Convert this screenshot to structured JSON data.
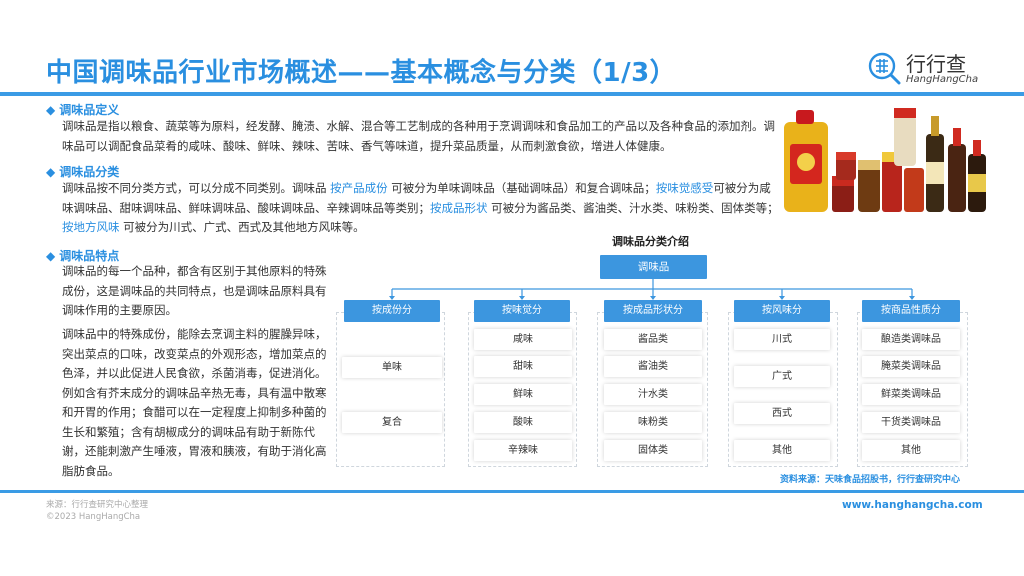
{
  "header": {
    "title": "中国调味品行业市场概述——基本概念与分类（1/3）",
    "logo_cn": "行行查",
    "logo_en": "HangHangCha"
  },
  "sections": {
    "definition": {
      "heading": "调味品定义",
      "text": "调味品是指以粮食、蔬菜等为原料，经发酵、腌渍、水解、混合等工艺制成的各种用于烹调调味和食品加工的产品以及各种食品的添加剂。调味品可以调配食品菜肴的咸味、酸味、鲜味、辣味、苦味、香气等味道，提升菜品质量，从而刺激食欲，增进人体健康。"
    },
    "classification": {
      "heading": "调味品分类",
      "p1": "调味品按不同分类方式，可以分成不同类别。调味品 ",
      "h1": "按产品成份",
      "p2": " 可被分为单味调味品（基础调味品）和复合调味品；",
      "h2": "按味觉感受",
      "p3": "可被分为咸味调味品、甜味调味品、鲜味调味品、酸味调味品、辛辣调味品等类别；",
      "h3": "按成品形状",
      "p4": " 可被分为酱品类、酱油类、汁水类、味粉类、固体类等；",
      "h4": "按地方风味",
      "p5": " 可被分为川式、广式、西式及其他地方风味等。"
    },
    "features": {
      "heading": "调味品特点",
      "para1": "调味品的每一个品种，都含有区别于其他原料的特殊成份，这是调味品的共同特点，也是调味品原料具有调味作用的主要原因。",
      "para2": "调味品中的特殊成份，能除去烹调主料的腥臊异味，突出菜点的口味，改变菜点的外观形态，增加菜点的色泽，并以此促进人民食欲，杀菌消毒，促进消化。例如含有芥末成分的调味品辛热无毒，具有温中散寒和开胃的作用；食醋可以在一定程度上抑制多种菌的生长和繁殖；含有胡椒成分的调味品有助于新陈代谢，还能刺激产生唾液，胃液和胰液，有助于消化高脂肪食品。"
    }
  },
  "diagram": {
    "title": "调味品分类介绍",
    "root": "调味品",
    "categories": [
      {
        "label": "按成份分",
        "items": [
          "单味",
          "复合"
        ]
      },
      {
        "label": "按味觉分",
        "items": [
          "咸味",
          "甜味",
          "鲜味",
          "酸味",
          "辛辣味"
        ]
      },
      {
        "label": "按成品形状分",
        "items": [
          "酱品类",
          "酱油类",
          "汁水类",
          "味粉类",
          "固体类"
        ]
      },
      {
        "label": "按风味分",
        "items": [
          "川式",
          "广式",
          "西式",
          "其他"
        ]
      },
      {
        "label": "按商品性质分",
        "items": [
          "酿造类调味品",
          "腌菜类调味品",
          "鲜菜类调味品",
          "干货类调味品",
          "其他"
        ]
      }
    ],
    "source": "资料来源：天味食品招股书，行行查研究中心"
  },
  "footer": {
    "line1": "来源：行行查研究中心整理",
    "line2": "©2023 HangHangCha",
    "site": "www.hanghangcha.com"
  },
  "colors": {
    "accent": "#2a8fe0",
    "box": "#3c96df",
    "rule": "#3a9be5"
  }
}
